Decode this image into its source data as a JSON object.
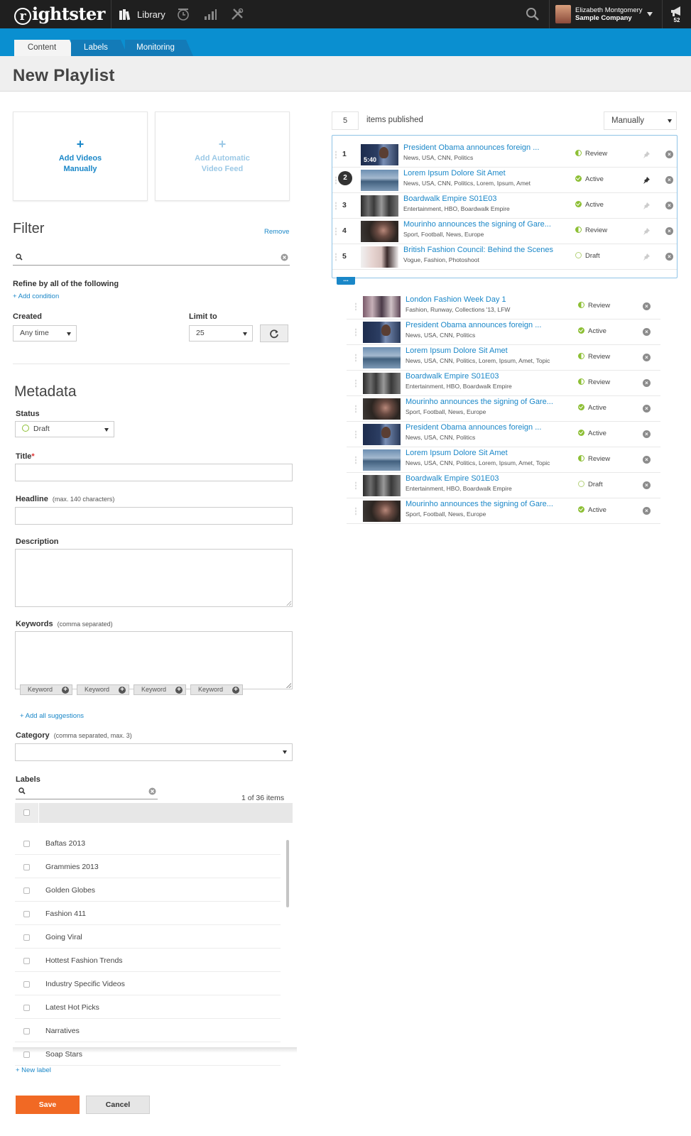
{
  "app": {
    "logo": "ightster",
    "logo_initial": "r",
    "nav_library": "Library",
    "user_name": "Elizabeth Montgomery",
    "company": "Sample Company",
    "notification_count": "52"
  },
  "tabs": [
    "Content",
    "Labels",
    "Monitoring"
  ],
  "page_title": "New Playlist",
  "add_buttons": {
    "manual_plus": "+",
    "manual_line1": "Add Videos",
    "manual_line2": "Manually",
    "auto_plus": "+",
    "auto_line1": "Add Automatic",
    "auto_line2": "Video Feed"
  },
  "filter": {
    "heading": "Filter",
    "remove": "Remove",
    "refine": "Refine by all of the following",
    "add_condition": "+ Add condition",
    "created_label": "Created",
    "created_value": "Any time",
    "limit_label": "Limit to",
    "limit_value": "25"
  },
  "metadata": {
    "heading": "Metadata",
    "status_label": "Status",
    "status_value": "Draft",
    "title_label": "Title",
    "title_required": "*",
    "headline_label": "Headline",
    "headline_hint": "(max. 140 characters)",
    "description_label": "Description",
    "keywords_label": "Keywords",
    "keywords_hint": "(comma separated)",
    "keyword_suggestions": [
      "Keyword",
      "Keyword",
      "Keyword",
      "Keyword"
    ],
    "add_all_suggestions": "+ Add all suggestions",
    "category_label": "Category",
    "category_hint": "(comma separated, max. 3)",
    "labels_label": "Labels",
    "labels_count": "1 of 36 items",
    "labels": [
      "Baftas 2013",
      "Grammies 2013",
      "Golden Globes",
      "Fashion 411",
      "Going Viral",
      "Hottest Fashion Trends",
      "Industry Specific Videos",
      "Latest Hot Picks",
      "Narratives",
      "Soap Stars"
    ],
    "new_label": "+ New label"
  },
  "actions": {
    "save": "Save",
    "cancel": "Cancel"
  },
  "published": {
    "count": "5",
    "text": "items published",
    "sort_value": "Manually",
    "more": "...",
    "duration": "5:40",
    "items": [
      {
        "num": "1",
        "title": "President Obama announces foreign ...",
        "tags": "News, USA, CNN, Politics",
        "status": "Review",
        "thumb": "obama"
      },
      {
        "num": "2",
        "title": "Lorem Ipsum Dolore Sit Amet",
        "tags": "News, USA, CNN, Politics, Lorem, Ipsum, Amet",
        "status": "Active",
        "thumb": "sea"
      },
      {
        "num": "3",
        "title": "Boardwalk Empire S01E03",
        "tags": "Entertainment, HBO, Boardwalk Empire",
        "status": "Active",
        "thumb": "boardwalk"
      },
      {
        "num": "4",
        "title": "Mourinho announces the signing of Gare...",
        "tags": "Sport, Football, News, Europe",
        "status": "Review",
        "thumb": "mourinho"
      },
      {
        "num": "5",
        "title": "British Fashion Council: Behind the Scenes",
        "tags": "Vogue, Fashion, Photoshoot",
        "status": "Draft",
        "thumb": "fashion"
      }
    ]
  },
  "results": [
    {
      "title": "London Fashion Week Day 1",
      "tags": "Fashion, Runway, Collections '13, LFW",
      "status": "Review",
      "thumb": "london"
    },
    {
      "title": "President Obama announces foreign ...",
      "tags": "News, USA, CNN, Politics",
      "status": "Active",
      "thumb": "obama"
    },
    {
      "title": "Lorem Ipsum Dolore Sit Amet",
      "tags": "News, USA, CNN, Politics, Lorem, Ipsum, Amet, Topic",
      "status": "Review",
      "thumb": "sea"
    },
    {
      "title": "Boardwalk Empire S01E03",
      "tags": "Entertainment, HBO, Boardwalk Empire",
      "status": "Review",
      "thumb": "boardwalk"
    },
    {
      "title": "Mourinho announces the signing of Gare...",
      "tags": "Sport, Football, News, Europe",
      "status": "Active",
      "thumb": "mourinho"
    },
    {
      "title": "President Obama announces foreign ...",
      "tags": "News, USA, CNN, Politics",
      "status": "Active",
      "thumb": "obama"
    },
    {
      "title": "Lorem Ipsum Dolore Sit Amet",
      "tags": "News, USA, CNN, Politics, Lorem, Ipsum, Amet, Topic",
      "status": "Review",
      "thumb": "sea"
    },
    {
      "title": "Boardwalk Empire S01E03",
      "tags": "Entertainment, HBO, Boardwalk Empire",
      "status": "Draft",
      "thumb": "boardwalk"
    },
    {
      "title": "Mourinho announces the signing of Gare...",
      "tags": "Sport, Football, News, Europe",
      "status": "Active",
      "thumb": "mourinho"
    }
  ],
  "colors": {
    "brand_blue": "#0a8fd0",
    "link_blue": "#1a87c8",
    "save_orange": "#f16924",
    "status_green": "#8dbf35"
  }
}
